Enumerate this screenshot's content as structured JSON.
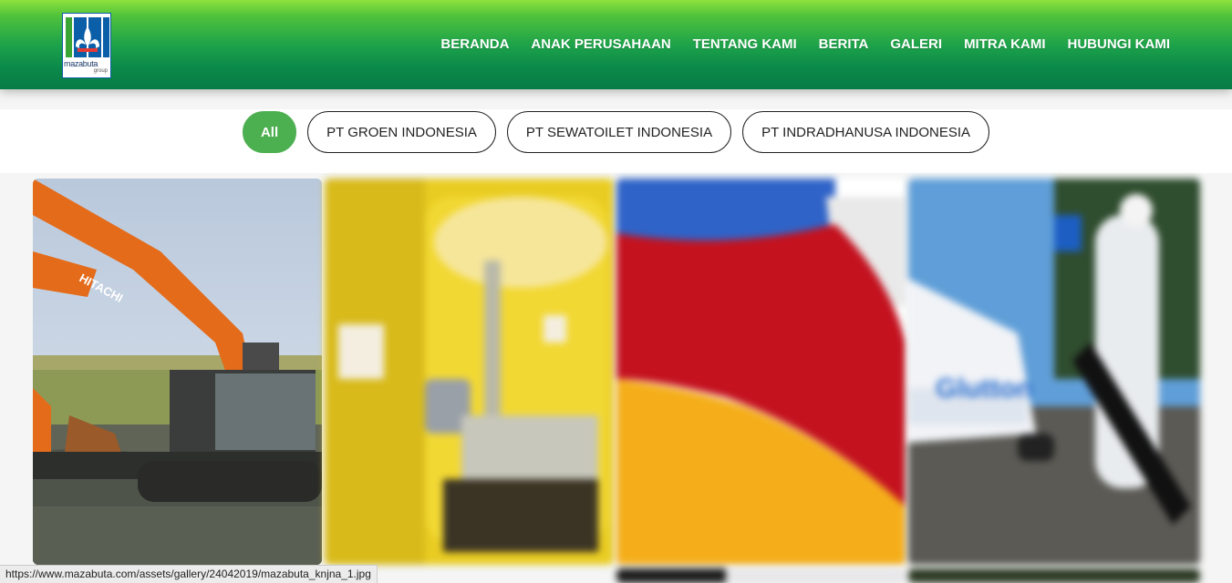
{
  "brand": {
    "logo_text": "mazabuta",
    "logo_subtext": "group",
    "colors": {
      "header_top": "#8ee23e",
      "header_bottom": "#077b45",
      "accent": "#4caf50"
    }
  },
  "nav": {
    "items": [
      {
        "label": "BERANDA"
      },
      {
        "label": "ANAK PERUSAHAAN"
      },
      {
        "label": "TENTANG KAMI"
      },
      {
        "label": "BERITA"
      },
      {
        "label": "GALERI"
      },
      {
        "label": "MITRA KAMI"
      },
      {
        "label": "HUBUNGI KAMI"
      }
    ]
  },
  "filters": {
    "items": [
      {
        "label": "All",
        "active": true
      },
      {
        "label": "PT GROEN INDONESIA",
        "active": false
      },
      {
        "label": "PT SEWATOILET INDONESIA",
        "active": false
      },
      {
        "label": "PT INDRADHANUSA INDONESIA",
        "active": false
      }
    ]
  },
  "gallery": {
    "items": [
      {
        "subject": "amphibious excavator",
        "label": "HITACHI"
      },
      {
        "subject": "portable toilet interior"
      },
      {
        "subject": "plastic pellets"
      },
      {
        "subject": "street cleaning vehicle",
        "label": "Glutton"
      }
    ]
  },
  "status_bar": {
    "url": "https://www.mazabuta.com/assets/gallery/24042019/mazabuta_knjna_1.jpg"
  }
}
